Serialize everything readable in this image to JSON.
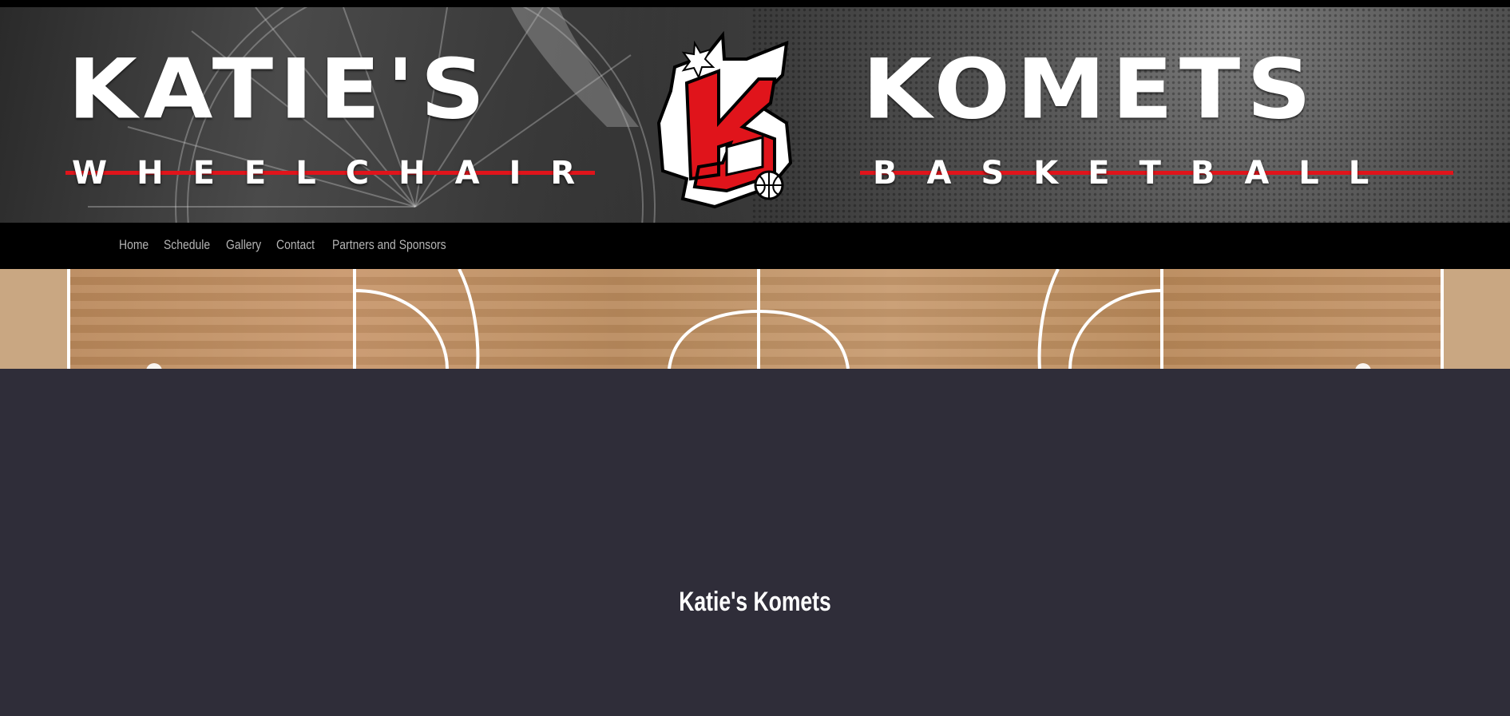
{
  "header": {
    "title_left": "KATIE'S",
    "title_right": "KOMETS",
    "subtitle_left": "WHEELCHAIR",
    "subtitle_right": "BASKETBALL",
    "logo_icon": "komets-k-logo-icon",
    "accent_color": "#e0141b"
  },
  "nav": {
    "items": [
      {
        "label": "Home"
      },
      {
        "label": "Schedule"
      },
      {
        "label": "Gallery"
      },
      {
        "label": "Contact"
      },
      {
        "label": "Partners and Sponsors"
      }
    ]
  },
  "main": {
    "heading": "Katie's Komets"
  },
  "colors": {
    "page_background": "#2f2d39",
    "nav_background": "#000000",
    "nav_text": "#b4b4b4"
  }
}
